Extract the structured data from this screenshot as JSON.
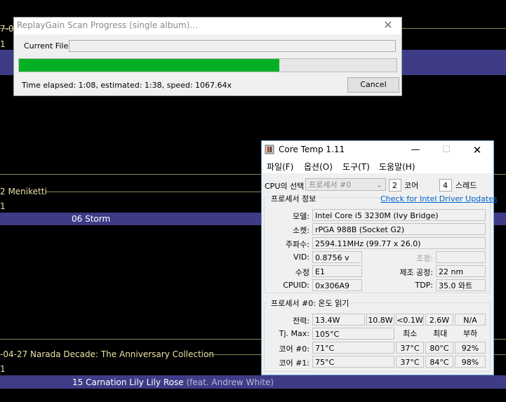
{
  "background": {
    "row1": {
      "left_text": "7-0",
      "sub_text": "1"
    },
    "row2": {
      "left_text": "2 Meniketti",
      "sub_text": "1",
      "track": "06  Storm"
    },
    "row3": {
      "left_text": "-04-27 Narada Decade: The Anniversary Collection",
      "sub_text": "1",
      "track": "15  Carnation Lily Lily Rose",
      "feat": " (feat. Andrew White)"
    }
  },
  "replaygain": {
    "title": "ReplayGain Scan Progress (single album)...",
    "current_file_label": "Current File:",
    "current_file_value": "",
    "progress": 0.69,
    "status": "Time elapsed: 1:08, estimated: 1:38, speed: 1067.64x",
    "cancel_label": "Cancel"
  },
  "coretemp": {
    "title": "Core Temp 1.11",
    "menu": [
      "파일(F)",
      "옵션(O)",
      "도구(T)",
      "도움말(H)"
    ],
    "cpu_select_label": "CPU의 선택",
    "cpu_select_value": "프로세서 #0",
    "cores": "2",
    "cores_label": "코어",
    "threads": "4",
    "threads_label": "스레드",
    "processor_info_title": "프로세서 정보",
    "driver_link": "Check for Intel Driver Updates",
    "model_label": "모델:",
    "model_value": "Intel Core i5 3230M (Ivy Bridge)",
    "socket_label": "소켓:",
    "socket_value": "rPGA 988B (Socket G2)",
    "freq_label": "주파수:",
    "freq_value": "2594.11MHz (99.77 x 26.0)",
    "vid_label": "VID:",
    "vid_value": "0.8756 v",
    "mod_label": "조정:",
    "mod_value": "",
    "rev_label": "수정",
    "rev_value": "E1",
    "lith_label": "제조 공정:",
    "lith_value": "22 nm",
    "cpuid_label": "CPUID:",
    "cpuid_value": "0x306A9",
    "tdp_label": "TDP:",
    "tdp_value": "35.0 와트",
    "temp_title": "프로세서 #0: 온도 읽기",
    "power_label": "전력:",
    "power_values": [
      "13.4W",
      "10.8W",
      "<0.1W",
      "2.6W",
      "N/A"
    ],
    "tjmax_label": "Tj. Max:",
    "tjmax_value": "105°C",
    "min_label": "최소",
    "max_label": "최대",
    "load_label": "부하",
    "core_rows": [
      {
        "label": "코어 #0:",
        "temp": "71°C",
        "min": "37°C",
        "max": "80°C",
        "load": "92%"
      },
      {
        "label": "코어 #1:",
        "temp": "75°C",
        "min": "37°C",
        "max": "84°C",
        "load": "98%"
      }
    ]
  }
}
